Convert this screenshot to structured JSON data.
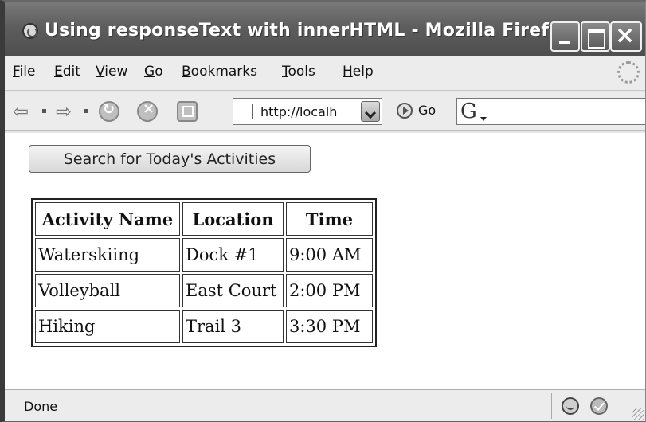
{
  "window": {
    "title": "Using responseText with innerHTML - Mozilla Firefox"
  },
  "menubar": {
    "items": [
      "File",
      "Edit",
      "View",
      "Go",
      "Bookmarks",
      "Tools",
      "Help"
    ]
  },
  "navbar": {
    "url": "http://localh",
    "go_label": "Go",
    "search_engine_letter": "G",
    "icons": [
      "back-icon",
      "forward-icon",
      "reload-icon",
      "stop-icon",
      "home-icon",
      "page-icon",
      "go-icon"
    ]
  },
  "page": {
    "search_button_label": "Search for Today's Activities",
    "table": {
      "headers": [
        "Activity Name",
        "Location",
        "Time"
      ],
      "rows": [
        [
          "Waterskiing",
          "Dock #1",
          "9:00 AM"
        ],
        [
          "Volleyball",
          "East Court",
          "2:00 PM"
        ],
        [
          "Hiking",
          "Trail 3",
          "3:30 PM"
        ]
      ]
    }
  },
  "statusbar": {
    "text": "Done"
  }
}
